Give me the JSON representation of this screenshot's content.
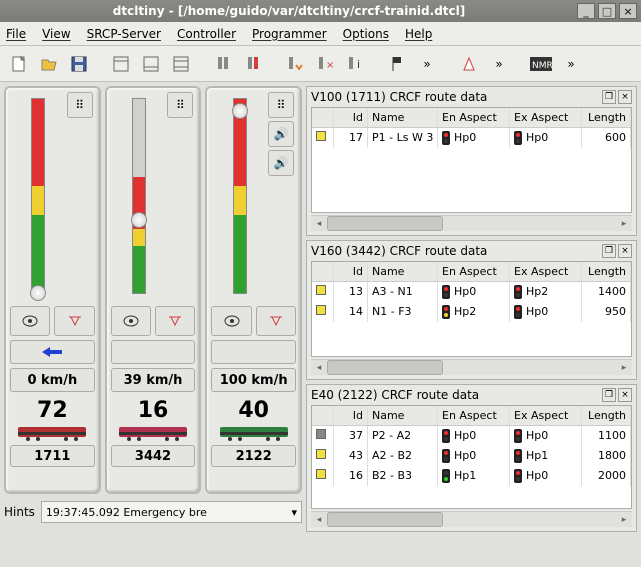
{
  "window": {
    "title": "dtcltiny - [/home/guido/var/dtcltiny/crcf-trainid.dtcl]"
  },
  "menu": {
    "file": "File",
    "view": "View",
    "srcp": "SRCP-Server",
    "controller": "Controller",
    "programmer": "Programmer",
    "options": "Options",
    "help": "Help"
  },
  "throttles": [
    {
      "speed": "0 km/h",
      "num": "72",
      "addr": "1711",
      "handle_pct": 96,
      "gray_pct": 0,
      "dir": "left",
      "loco_color": "#b03030"
    },
    {
      "speed": "39 km/h",
      "num": "16",
      "addr": "3442",
      "handle_pct": 58,
      "gray_pct": 40,
      "dir": "none",
      "loco_color": "#b03050"
    },
    {
      "speed": "100 km/h",
      "num": "40",
      "addr": "2122",
      "handle_pct": 2,
      "gray_pct": 0,
      "dir": "none",
      "loco_color": "#308040"
    }
  ],
  "hints": {
    "label": "Hints",
    "value": "19:37:45.092 Emergency bre"
  },
  "panels": [
    {
      "title": "V100 (1711) CRCF route data",
      "headers": {
        "id": "Id",
        "name": "Name",
        "en": "En Aspect",
        "ex": "Ex Aspect",
        "len": "Length"
      },
      "rows": [
        {
          "mark": "y",
          "id": "17",
          "name": "P1 - Ls W 3",
          "en_sig": "r",
          "en": "Hp0",
          "ex_sig": "r",
          "ex": "Hp0",
          "len": "600"
        }
      ]
    },
    {
      "title": "V160 (3442) CRCF route data",
      "headers": {
        "id": "Id",
        "name": "Name",
        "en": "En Aspect",
        "ex": "Ex Aspect",
        "len": "Length"
      },
      "rows": [
        {
          "mark": "y",
          "id": "13",
          "name": "A3 - N1",
          "en_sig": "r",
          "en": "Hp0",
          "ex_sig": "r",
          "ex": "Hp2",
          "len": "1400"
        },
        {
          "mark": "y",
          "id": "14",
          "name": "N1 - F3",
          "en_sig": "ry",
          "en": "Hp2",
          "ex_sig": "r",
          "ex": "Hp0",
          "len": "950"
        }
      ]
    },
    {
      "title": "E40 (2122) CRCF route data",
      "headers": {
        "id": "Id",
        "name": "Name",
        "en": "En Aspect",
        "ex": "Ex Aspect",
        "len": "Length"
      },
      "rows": [
        {
          "mark": "g",
          "id": "37",
          "name": "P2 - A2",
          "en_sig": "r",
          "en": "Hp0",
          "ex_sig": "r",
          "ex": "Hp0",
          "len": "1100"
        },
        {
          "mark": "y",
          "id": "43",
          "name": "A2 - B2",
          "en_sig": "r",
          "en": "Hp0",
          "ex_sig": "r",
          "ex": "Hp1",
          "len": "1800"
        },
        {
          "mark": "y",
          "id": "16",
          "name": "B2 - B3",
          "en_sig": "g",
          "en": "Hp1",
          "ex_sig": "r",
          "ex": "Hp0",
          "len": "2000"
        }
      ]
    }
  ]
}
